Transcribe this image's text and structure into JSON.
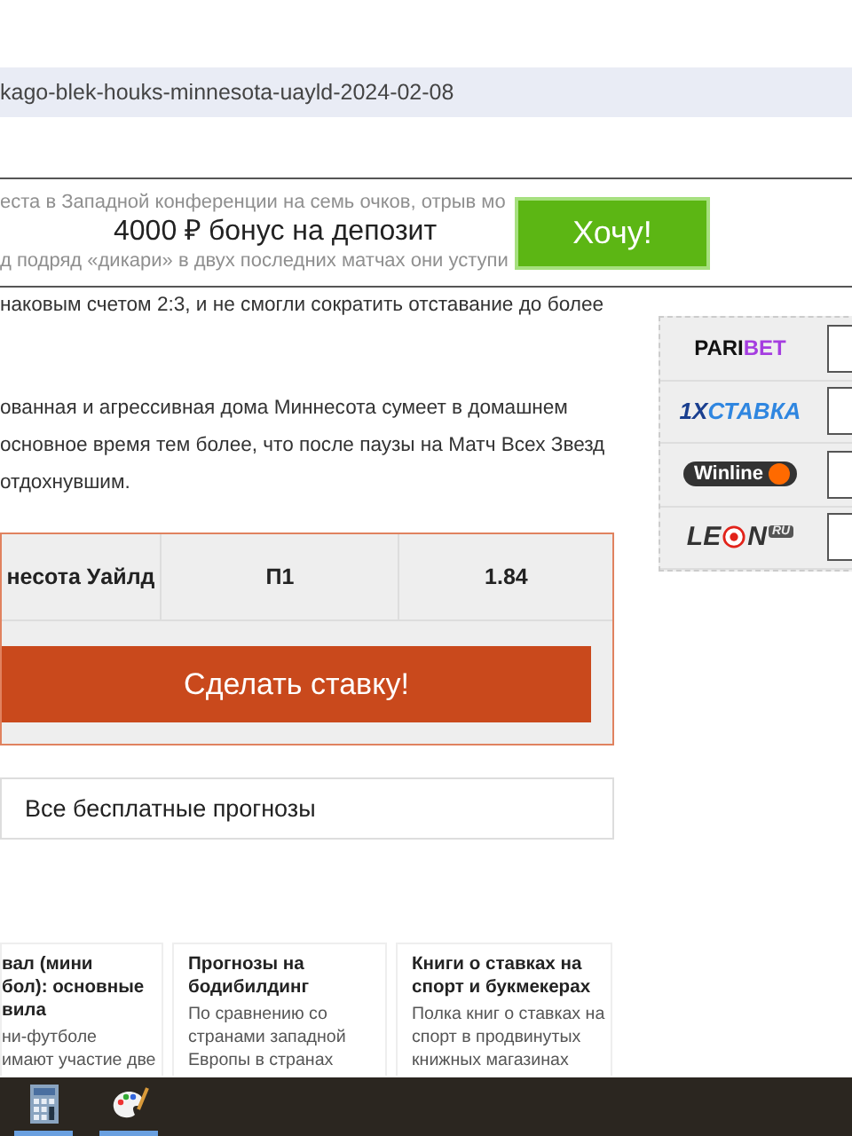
{
  "address_bar": {
    "url": "kago-blek-houks-minnesota-uayld-2024-02-08"
  },
  "promo_banner": {
    "faded_lines": [
      "еста в Западной конференции на семь очков, отрыв мо",
      "д подряд «дикари» в двух последних матчах они уступи"
    ],
    "text": "4000 ₽ бонус на депозит",
    "button": "Хочу!"
  },
  "article": {
    "lines": [
      "наковым счетом 2:3, и не смогли сократить отставание до более"
    ],
    "paragraph": [
      "ованная и агрессивная дома Миннесота сумеет в домашнем",
      "основное время тем более, что после паузы на Матч Всех Звезд",
      "отдохнувшим."
    ]
  },
  "bet_table": {
    "cells": [
      "несота Уайлд",
      "П1",
      "1.84"
    ],
    "button": "Сделать ставку!"
  },
  "all_forecasts_link": "Все бесплатные прогнозы",
  "cards": [
    {
      "title": "вал (мини\nбол): основные\nвила",
      "text": "ни-футболе\nимают участие две"
    },
    {
      "title": "Прогнозы на\nбодибилдинг",
      "text": "По сравнению со\nстранами западной\nЕвропы в странах"
    },
    {
      "title": "Книги о ставках на\nспорт и букмекерах",
      "text": "Полка книг о ставках на\nспорт в продвинутых\nкнижных магазинах"
    }
  ],
  "bookmakers": [
    {
      "kind": "paribet",
      "parts": [
        "PARI",
        "BET"
      ]
    },
    {
      "kind": "xstavka",
      "parts": [
        "1X",
        "СТАВКА"
      ]
    },
    {
      "kind": "winline",
      "parts": [
        "Winline"
      ]
    },
    {
      "kind": "leon",
      "parts": [
        "LE",
        "N"
      ],
      "badge": "RU"
    }
  ],
  "taskbar": {
    "apps": [
      {
        "kind": "calculator"
      },
      {
        "kind": "paint"
      }
    ]
  }
}
